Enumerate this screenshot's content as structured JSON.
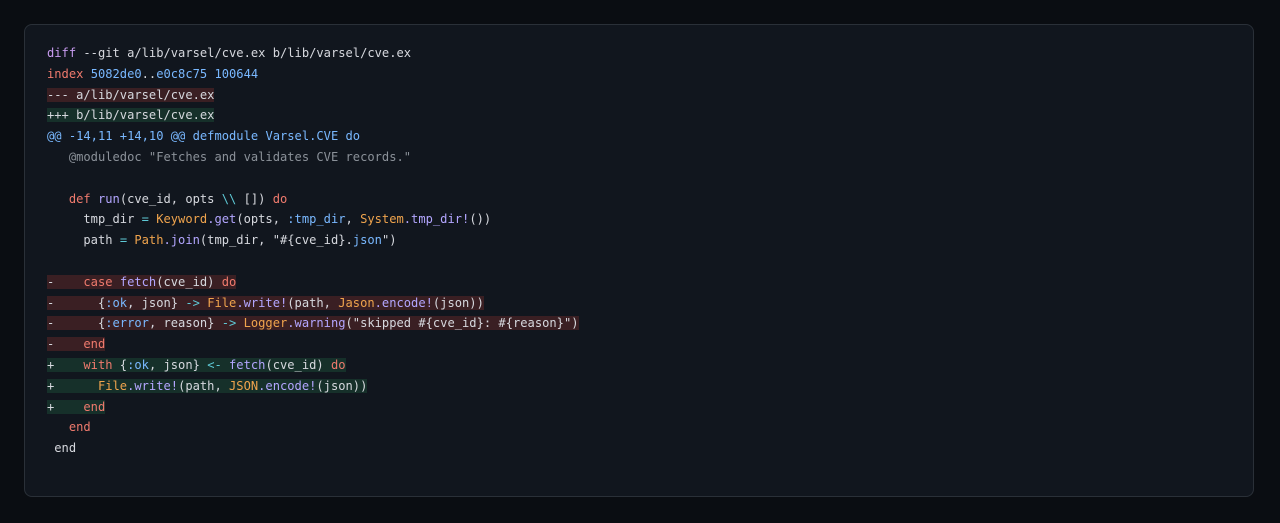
{
  "diff": {
    "header": {
      "cmd": "diff",
      "args": " --git a/lib/varsel/cve.ex b/lib/varsel/cve.ex",
      "index_kw": "index",
      "index_from": "5082de0",
      "index_sep": "..",
      "index_to": "e0c8c75",
      "index_mode": "100644",
      "old_file": "--- a/lib/varsel/cve.ex",
      "new_file": "+++ b/lib/varsel/cve.ex"
    },
    "hunk": {
      "range": "@@ -14,11 +14,10 @@",
      "context_kw": "defmodule",
      "context_name": "Varsel.CVE",
      "context_do": "do"
    },
    "lines": {
      "moduledoc": "   @moduledoc \"Fetches and validates CVE records.\"",
      "def_indent": "   ",
      "def_kw": "def",
      "def_name": "run",
      "def_args_a": "(cve_id, opts ",
      "def_default_op": "\\\\",
      "def_args_b": " [])",
      "def_do": "do",
      "tmp_lhs": "     tmp_dir ",
      "tmp_eq": "=",
      "tmp_mod": "Keyword",
      "tmp_fn": ".get",
      "tmp_args_a": "(opts, ",
      "tmp_atom": ":tmp_dir",
      "tmp_args_b": ", ",
      "tmp_mod2": "System",
      "tmp_fn2": ".tmp_dir!",
      "tmp_args_c": "())",
      "path_lhs": "     path ",
      "path_eq": "=",
      "path_mod": "Path",
      "path_fn": ".join",
      "path_args_a": "(tmp_dir, \"#{cve_id}.",
      "path_ext": "json",
      "path_args_b": "\")",
      "r1_sign": "-",
      "r1_indent": "    ",
      "r1_kw": "case",
      "r1_fn": "fetch",
      "r1_args": "(cve_id) ",
      "r1_do": "do",
      "r2_sign": "-",
      "r2_indent": "      {",
      "r2_atom": ":ok",
      "r2_mid": ", json} ",
      "r2_arrow": "->",
      "r2_mod": "File",
      "r2_fn": ".write!",
      "r2_args_a": "(path, ",
      "r2_mod2": "Jason",
      "r2_fn2": ".encode!",
      "r2_args_b": "(json))",
      "r3_sign": "-",
      "r3_indent": "      {",
      "r3_atom": ":error",
      "r3_mid": ", reason} ",
      "r3_arrow": "->",
      "r3_mod": "Logger",
      "r3_fn": ".warning",
      "r3_str": "(\"skipped #{cve_id}: #{reason}\")",
      "r4_sign": "-",
      "r4_indent": "    ",
      "r4_kw": "end",
      "a1_sign": "+",
      "a1_indent": "    ",
      "a1_kw": "with",
      "a1_open": " {",
      "a1_atom": ":ok",
      "a1_mid": ", json} ",
      "a1_arrow": "<-",
      "a1_fn": "fetch",
      "a1_args": "(cve_id) ",
      "a1_do": "do",
      "a2_sign": "+",
      "a2_indent": "      ",
      "a2_mod": "File",
      "a2_fn": ".write!",
      "a2_args_a": "(path, ",
      "a2_mod2": "JSON",
      "a2_fn2": ".encode!",
      "a2_args_b": "(json))",
      "a3_sign": "+",
      "a3_indent": "    ",
      "a3_kw": "end",
      "end1": "   end",
      "end2": " end"
    }
  }
}
